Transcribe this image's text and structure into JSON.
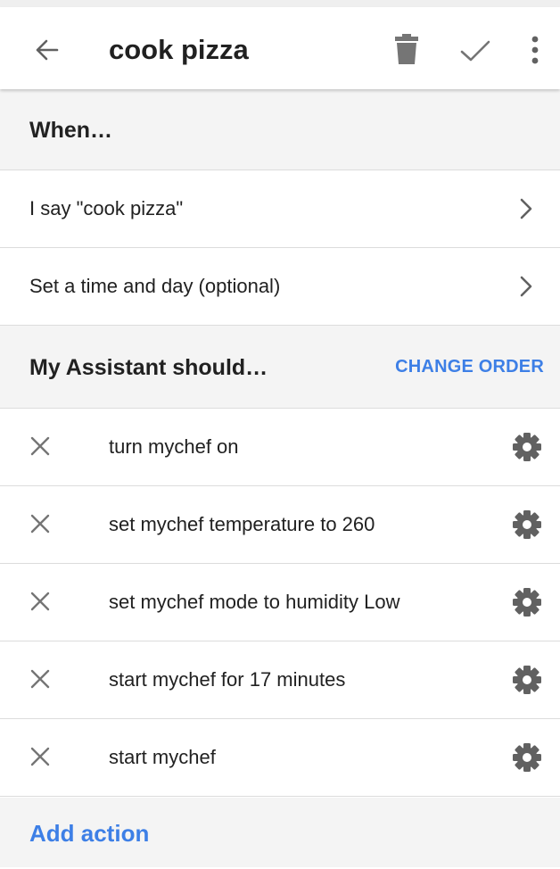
{
  "appbar": {
    "title": "cook pizza",
    "icons": [
      "arrow-back-icon",
      "trash-icon",
      "check-icon",
      "more-vert-icon"
    ]
  },
  "when_section": {
    "heading": "When…",
    "items": [
      {
        "label": "I say \"cook pizza\""
      },
      {
        "label": "Set a time and day (optional)"
      }
    ]
  },
  "actions_section": {
    "heading": "My Assistant should…",
    "change_order_label": "CHANGE ORDER",
    "actions": [
      {
        "label": "turn mychef on"
      },
      {
        "label": "set mychef temperature to 260"
      },
      {
        "label": "set mychef mode to humidity Low"
      },
      {
        "label": "start mychef for 17 minutes"
      },
      {
        "label": "start mychef"
      }
    ]
  },
  "footer": {
    "add_action_label": "Add action"
  },
  "colors": {
    "accent": "#3d7fe6",
    "section_bg": "#f4f4f4",
    "divider": "#dcdcdc",
    "icon_gray": "#757575"
  }
}
